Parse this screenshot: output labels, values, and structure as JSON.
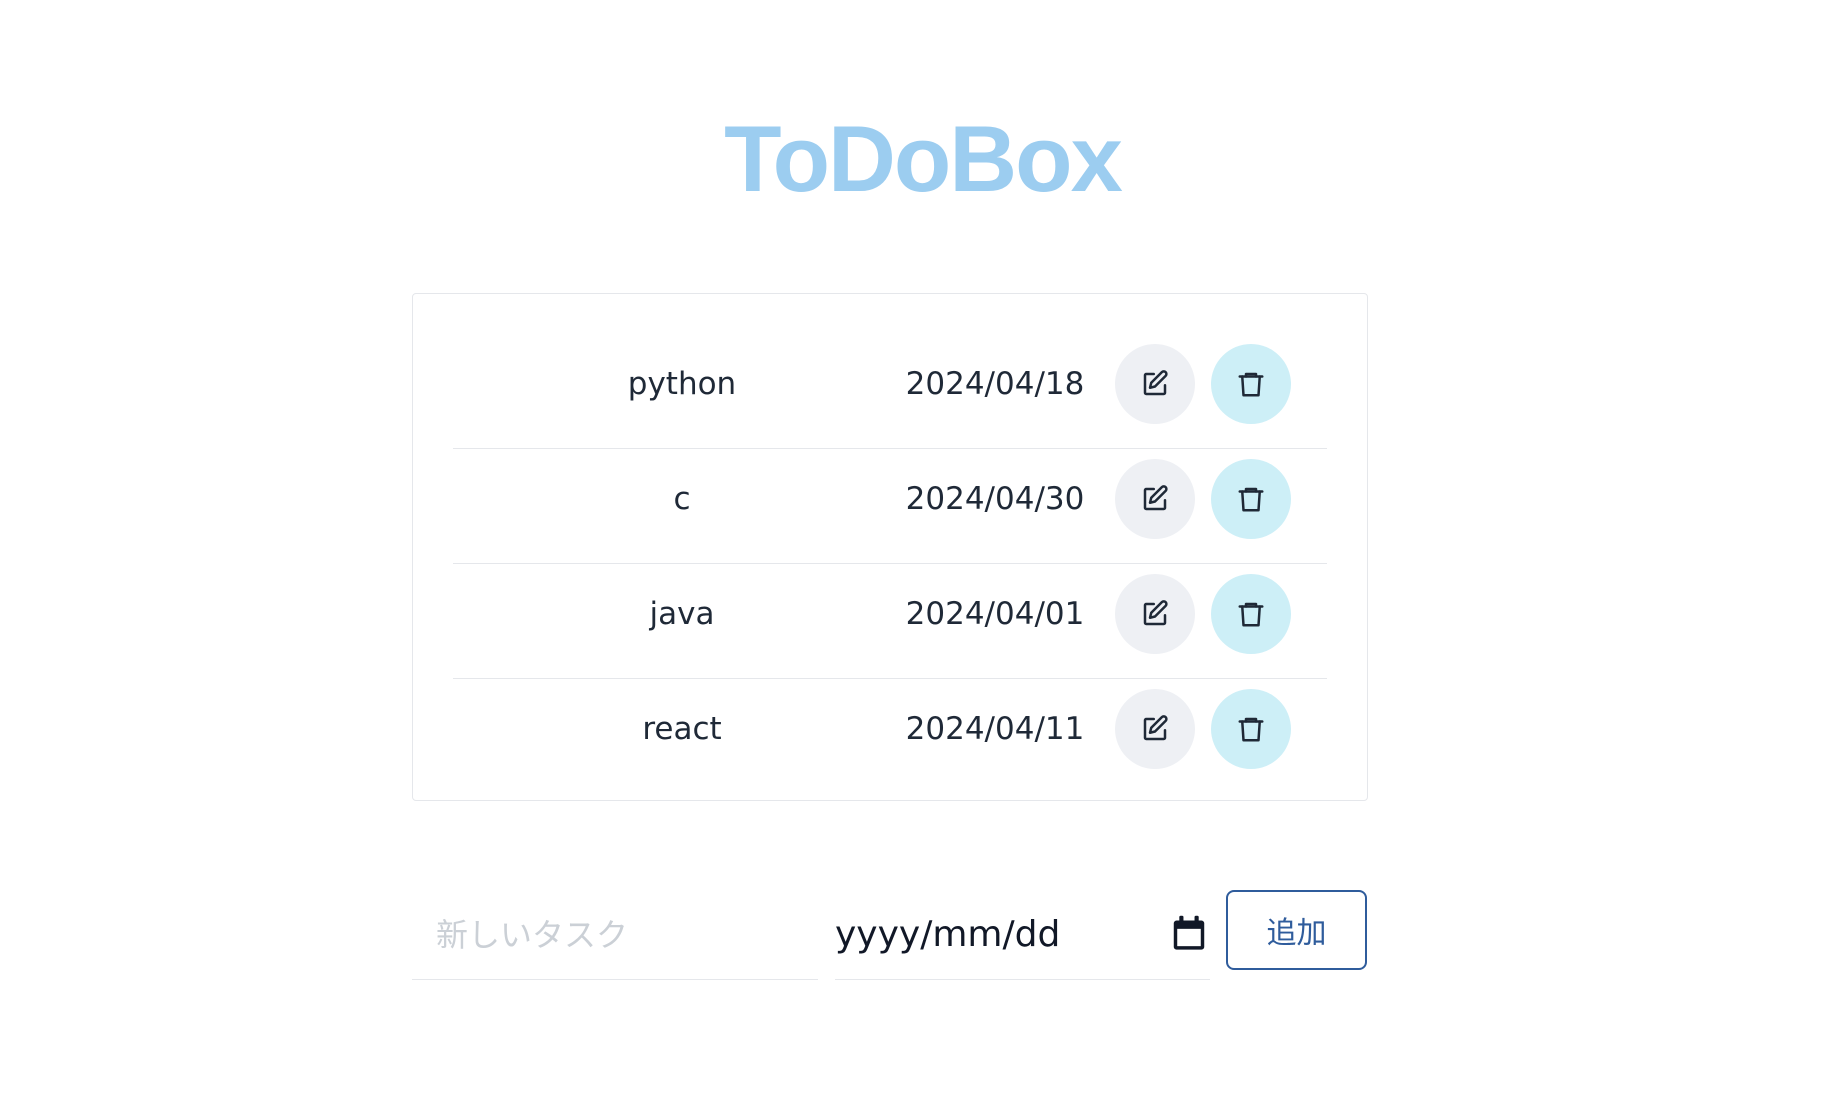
{
  "app": {
    "title": "ToDoBox"
  },
  "tasks": [
    {
      "name": "python",
      "date": "2024/04/18"
    },
    {
      "name": "c",
      "date": "2024/04/30"
    },
    {
      "name": "java",
      "date": "2024/04/01"
    },
    {
      "name": "react",
      "date": "2024/04/11"
    }
  ],
  "form": {
    "task_placeholder": "新しいタスク",
    "task_value": "",
    "date_placeholder": "yyyy/mm/dd",
    "add_label": "追加"
  },
  "icons": {
    "edit": "edit-icon",
    "delete": "trash-icon",
    "calendar": "calendar-icon"
  },
  "colors": {
    "title": "#9ccdf0",
    "edit_button_bg": "#eef0f4",
    "delete_button_bg": "#cdeff7",
    "add_button": "#2f5c9c",
    "divider": "#e5e7eb"
  }
}
